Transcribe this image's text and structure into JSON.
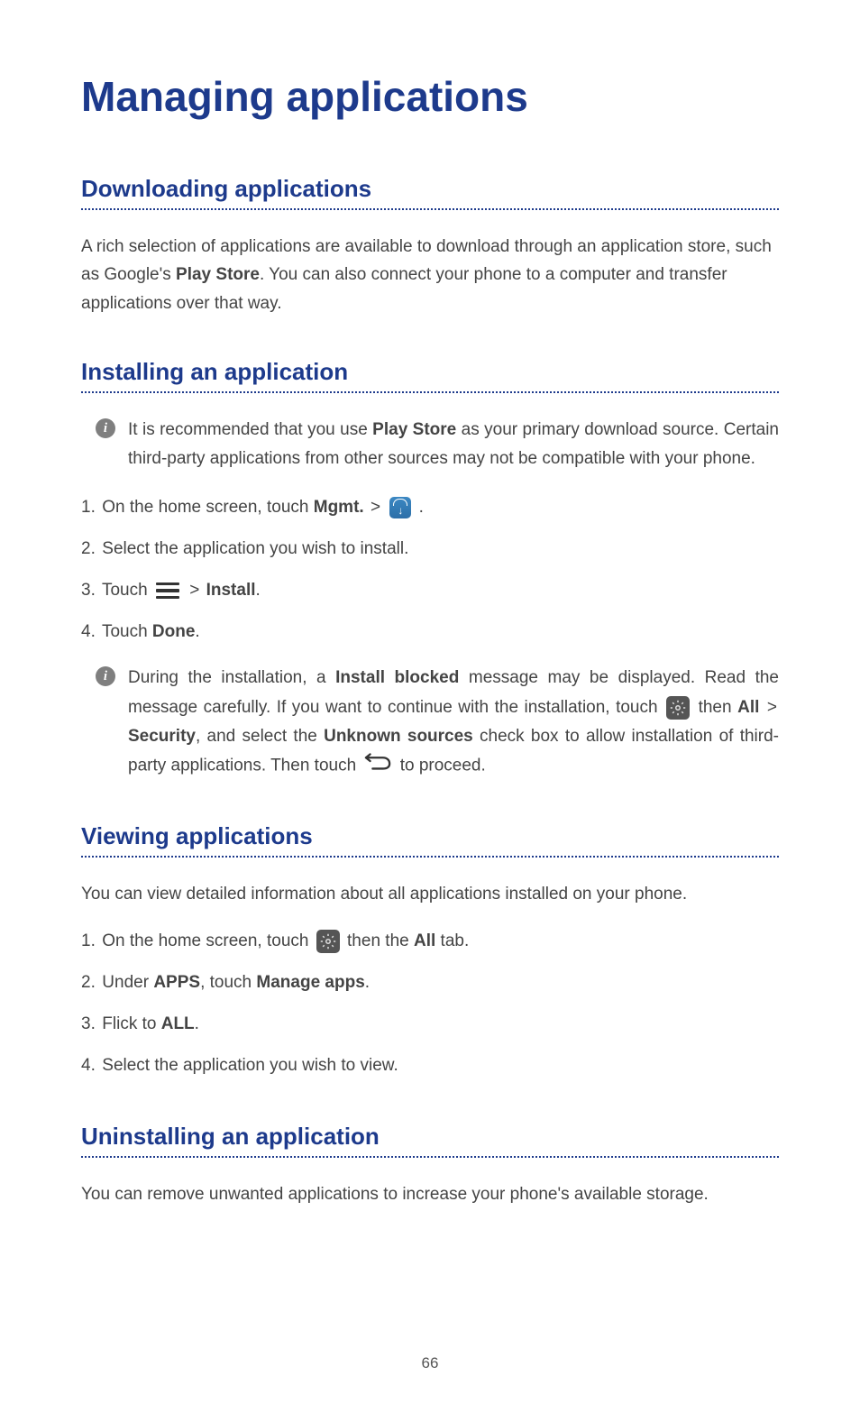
{
  "title": "Managing applications",
  "page_number": "66",
  "sections": {
    "downloading": {
      "title": "Downloading applications",
      "body_pre": "A rich selection of applications are available to download through an application store, such as Google's ",
      "play_store": "Play Store",
      "body_post": ". You can also connect your phone to a computer and transfer applications over that way."
    },
    "installing": {
      "title": "Installing an application",
      "note1_pre": "It is recommended that you use ",
      "note1_bold": "Play Store",
      "note1_post": " as your primary download source. Certain third-party applications from other sources may not be compatible with your phone.",
      "step1_pre": "On the home screen, touch ",
      "step1_mgmt": "Mgmt.",
      "step1_post": " .",
      "step2": "Select the application you wish to install.",
      "step3_pre": "Touch ",
      "step3_install": "Install",
      "step3_post": ".",
      "step4_pre": "Touch ",
      "step4_done": "Done",
      "step4_post": ".",
      "note2_pre": "During the installation, a ",
      "note2_bold1": "Install blocked",
      "note2_mid1": " message may be displayed. Read the message carefully. If you want to continue with the installation, touch ",
      "note2_then": " then ",
      "note2_all": "All",
      "note2_security": "Security",
      "note2_mid2": ", and select the ",
      "note2_unknown": "Unknown sources",
      "note2_mid3": " check box to allow installation of third-party applications. Then touch ",
      "note2_post": "to proceed."
    },
    "viewing": {
      "title": "Viewing applications",
      "body": "You can view detailed information about all applications installed on your phone.",
      "step1_pre": "On the home screen, touch ",
      "step1_mid": " then the ",
      "step1_all": "All",
      "step1_post": " tab.",
      "step2_pre": "Under ",
      "step2_apps": "APPS",
      "step2_mid": ", touch ",
      "step2_manage": "Manage apps",
      "step2_post": ".",
      "step3_pre": "Flick to ",
      "step3_all": "ALL",
      "step3_post": ".",
      "step4": "Select the application you wish to view."
    },
    "uninstalling": {
      "title": "Uninstalling an application",
      "body": "You can remove unwanted applications to increase your phone's available storage."
    }
  },
  "info_glyph": "i",
  "gt": ">"
}
